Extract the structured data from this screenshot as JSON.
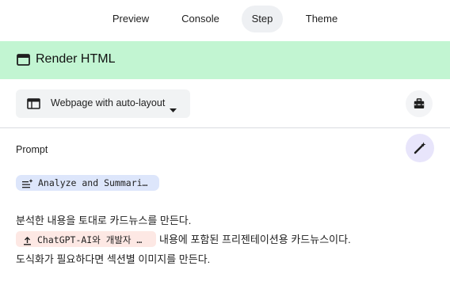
{
  "tabs": [
    {
      "label": "Preview",
      "active": false
    },
    {
      "label": "Console",
      "active": false
    },
    {
      "label": "Step",
      "active": true
    },
    {
      "label": "Theme",
      "active": false
    }
  ],
  "header": {
    "title": "Render HTML",
    "icon": "web-window-icon",
    "background": "#c2f5d2"
  },
  "layout_select": {
    "value": "Webpage with auto-layout",
    "icon": "webpage-layout-icon"
  },
  "toolbox_button": {
    "icon": "toolbox-icon"
  },
  "prompt": {
    "label": "Prompt",
    "wand_icon": "magic-wand-icon",
    "step_chip": {
      "label": "Analyze and Summari…",
      "icon": "list-sparkle-icon"
    },
    "lines": {
      "line1": "분석한 내용을 토대로 카드뉴스를 만든다.",
      "file_chip": {
        "label": "ChatGPT-AI와 개발자 …",
        "icon": "upload-icon"
      },
      "line2_rest": "내용에 포함된 프리젠테이션용 카드뉴스이다.",
      "line3": "도식화가 필요하다면 섹션별 이미지를 만든다."
    }
  }
}
